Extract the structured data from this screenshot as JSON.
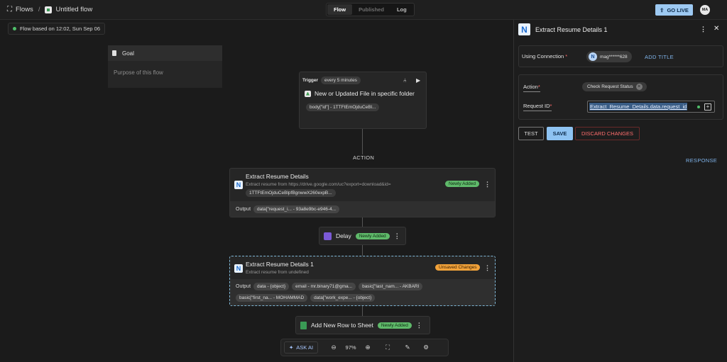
{
  "header": {
    "breadcrumb_root": "Flows",
    "breadcrumb_sep": "/",
    "flow_name": "Untitled flow",
    "tabs": [
      {
        "label": "Flow",
        "state": "active"
      },
      {
        "label": "Published",
        "state": "disabled"
      },
      {
        "label": "Log",
        "state": "normal"
      }
    ],
    "go_live": "GO LIVE",
    "avatar": "MA"
  },
  "canvas": {
    "flow_badge": "Flow based on 12:02, Sun Sep 06",
    "goal": {
      "title": "Goal",
      "placeholder": "Purpose of this flow"
    },
    "trigger": {
      "label": "Trigger",
      "interval": "every 5 minutes",
      "title": "New or Updated File in specific folder",
      "output_pill": "body[\"id\"] - 1TTFtEmOjduCeBl..."
    },
    "section_label": "ACTION",
    "step1": {
      "title": "Extract Resume Details",
      "subtitle": "Extract resume from https://drive.google.com/uc?export=download&id=",
      "sub_pill": "1TTFtEmOjduCeBlpfBgnwwX260expB...",
      "status": "Newly Added",
      "output_label": "Output",
      "outputs": [
        "data[\"request_i... - 93a8e9bc-e946-4..."
      ]
    },
    "delay": {
      "title": "Delay",
      "status": "Newly Added"
    },
    "step2": {
      "title": "Extract Resume Details 1",
      "subtitle": "Extract resume from undefined",
      "status": "Unsaved Changes",
      "output_label": "Output",
      "outputs": [
        "data - {object}",
        "email - mr.binary71@gma...",
        "basic[\"last_nam... - AKBARI",
        "basic[\"first_na... - MOHAMMAD",
        "data[\"work_expe... - {object}"
      ]
    },
    "add_row": {
      "title": "Add New Row to Sheet",
      "status": "Newly Added"
    },
    "toolbar": {
      "ask_ai": "ASK AI",
      "zoom": "97%"
    }
  },
  "panel": {
    "title": "Extract Resume Details 1",
    "connection_label": "Using Connection",
    "connection_value": "mag******628",
    "add_title": "ADD TITLE",
    "action_label": "Action",
    "action_value": "Check Request Status",
    "request_label": "Request ID",
    "request_value": "Extract_Resume_Details.data.request_id",
    "required_mark": "*",
    "test": "TEST",
    "save": "SAVE",
    "discard": "DISCARD CHANGES",
    "response": "RESPONSE"
  },
  "colors": {
    "accent": "#8ec3f2",
    "newly_added": "#5fb96a",
    "unsaved": "#f1a23a",
    "danger": "#ff6e6e"
  }
}
